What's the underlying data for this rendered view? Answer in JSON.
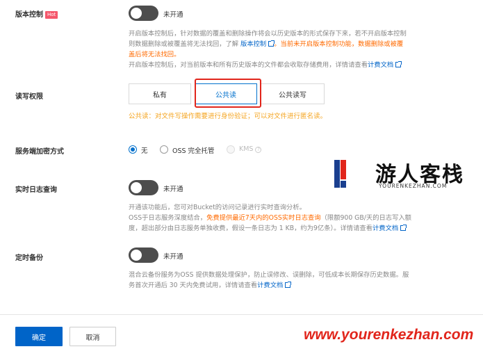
{
  "versioning": {
    "label": "版本控制",
    "hot_badge": "Hot",
    "toggle_state": "未开通",
    "desc1_a": "开启版本控制后，针对数据的覆盖和删除操作将会以历史版本的形式保存下来，若不开启版本控制",
    "desc2_a": "则数据删除或被覆盖将无法找回，了解 ",
    "desc2_link": "版本控制",
    "desc2_warn": "。当前未开启版本控制功能，数据删除或被覆",
    "desc3_warn": "盖后将无法找回。",
    "desc4_a": "开启版本控制后，对当前版本和所有历史版本的文件都会收取存储费用，详情请查看",
    "desc4_link": "计费文档"
  },
  "acl": {
    "label": "读写权限",
    "options": [
      "私有",
      "公共读",
      "公共读写"
    ],
    "selected": "公共读",
    "tip": "公共读：对文件写操作需要进行身份验证；可以对文件进行匿名读。"
  },
  "encryption": {
    "label": "服务端加密方式",
    "options": [
      "无",
      "OSS 完全托管",
      "KMS"
    ],
    "selected": "无",
    "disabled": "KMS",
    "help_glyph": "?"
  },
  "realtime_log": {
    "label": "实时日志查询",
    "toggle_state": "未开通",
    "desc1": "开通该功能后，您可对Bucket的访问记录进行实时查询分析。",
    "desc2_a": "OSS于日志服务深度结合，",
    "desc2_warn": "免费提供最近7天内的OSS实时日志查询",
    "desc2_b": "（限额900 GB/天的日志写入额",
    "desc3_a": "度，超出部分由日志服务单独收费，假设一条日志为 1 KB，约为9亿条）。详情请查看",
    "desc3_link": "计费文档"
  },
  "backup": {
    "label": "定时备份",
    "toggle_state": "未开通",
    "desc1": "混合云备份服务为OSS 提供数据处理保护，防止误修改、误删除，可低成本长期保存历史数据。服",
    "desc2_a": "务首次开通后 30 天内免费试用，详情请查看",
    "desc2_link": "计费文档"
  },
  "footer": {
    "confirm": "确定",
    "cancel": "取消"
  },
  "watermark": {
    "brand": "游人客栈",
    "brand_url_small": "YOURENKEZHAN.COM",
    "url": "www.yourenkezhan.com"
  },
  "colors": {
    "primary": "#0064c8",
    "warning": "#ff6a00",
    "tip": "#f5a623",
    "hot": "#f5576c",
    "highlight_box": "#e1251b"
  }
}
